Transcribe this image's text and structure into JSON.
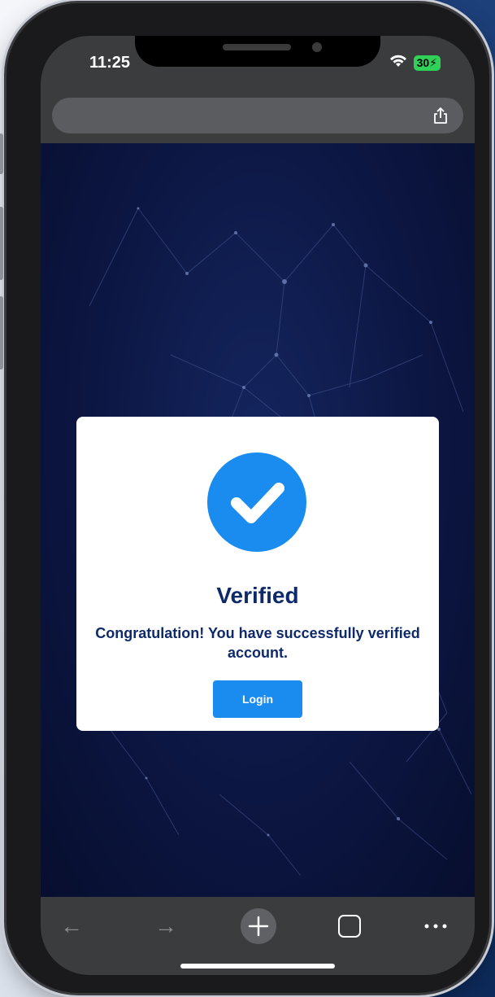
{
  "status_bar": {
    "time": "11:25",
    "battery": "30"
  },
  "modal": {
    "title": "Verified",
    "message": "Congratulation! You have successfully verified account.",
    "login_label": "Login"
  },
  "colors": {
    "accent": "#1a8cf0",
    "title_text": "#0e2a6b",
    "battery_green": "#30d158",
    "browser_chrome": "#3a3c3e",
    "page_background": "#0c1642"
  },
  "icons": {
    "share": "share-icon",
    "check": "checkmark-circle-icon",
    "back": "arrow-left-icon",
    "forward": "arrow-right-icon",
    "new_tab": "plus-circle-icon",
    "tabs": "tabs-square-icon",
    "more": "more-dots-icon",
    "wifi": "wifi-icon",
    "battery": "battery-icon"
  }
}
